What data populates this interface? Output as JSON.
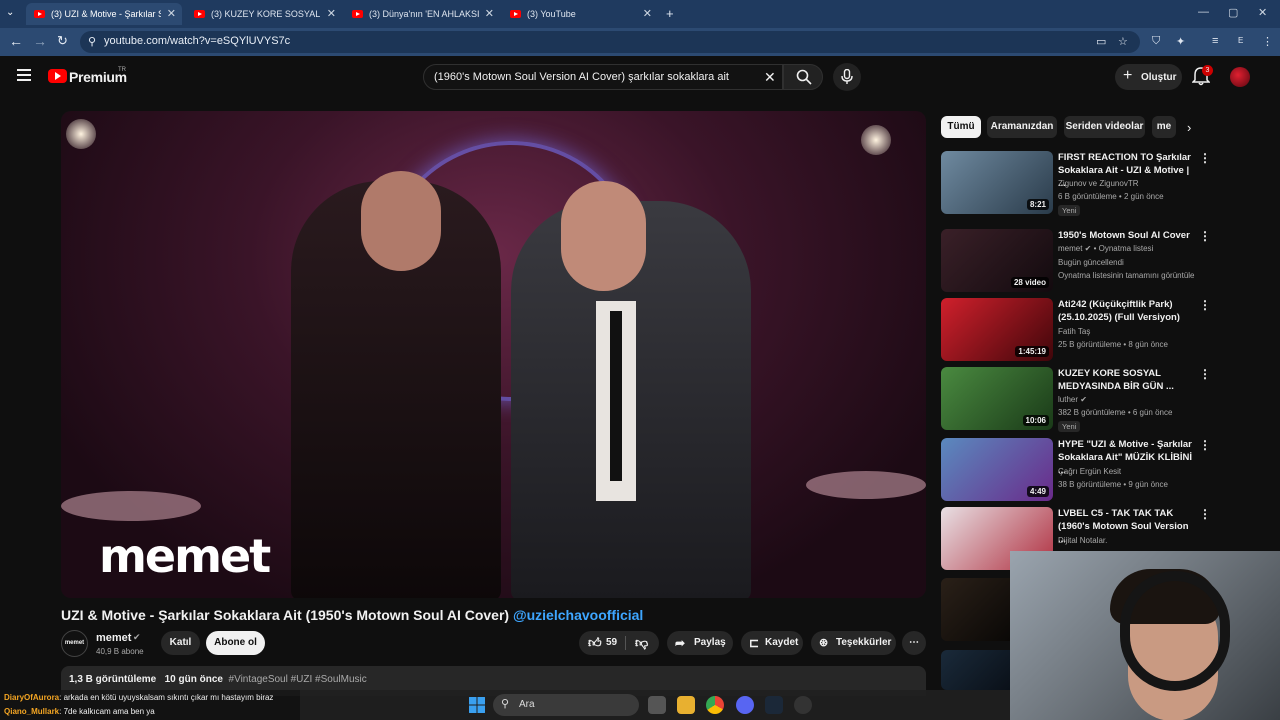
{
  "browser": {
    "tabs": [
      {
        "title": "(3) UZI & Motive - Şarkılar Soka",
        "active": true
      },
      {
        "title": "(3) KUZEY KORE SOSYAL MEDYA",
        "active": false
      },
      {
        "title": "(3) Dünya'nın 'EN AHLAKSIZ' B",
        "active": false
      },
      {
        "title": "(3) YouTube",
        "active": false
      }
    ],
    "new_tab": "+",
    "url": "youtube.com/watch?v=eSQYlUVYS7c",
    "profile_initial": "E"
  },
  "header": {
    "logo_text": "Premium",
    "logo_region": "TR",
    "search_value": "(1960's Motown Soul Version AI Cover) şarkılar sokaklara ait",
    "create_label": "Oluştur",
    "notification_count": "3"
  },
  "video": {
    "watermark": "memet",
    "title": "UZI & Motive - Şarkılar Sokaklara Ait (1950's Motown Soul AI Cover)",
    "title_tag": "@uzielchavoofficial",
    "channel": {
      "name": "memet",
      "subscribers": "40,9 B abone",
      "avatar_text": "memet"
    },
    "join_label": "Katıl",
    "subscribe_label": "Abone ol",
    "like_count": "59",
    "share_label": "Paylaş",
    "save_label": "Kaydet",
    "thanks_label": "Teşekkürler",
    "views": "1,3 B görüntüleme",
    "age": "10 gün önce",
    "hashtags": "#VintageSoul #UZI #SoulMusic"
  },
  "chips": [
    "Tümü",
    "Aramanızdan",
    "Seriden videolar",
    "me"
  ],
  "related": [
    {
      "title": "FIRST REACTION TO Şarkılar Sokaklara Ait - UZI & Motive | ...",
      "channel": "Zigunov ve ZigunovTR",
      "meta": "6 B görüntüleme • 2 gün önce",
      "duration": "8:21",
      "badge": "Yeni"
    },
    {
      "title": "1950's Motown Soul AI Cover",
      "channel": "memet ✔ • Oynatma listesi",
      "meta": "Bugün güncellendi",
      "meta2": "Oynatma listesinin tamamını görüntüle",
      "duration": "28 video"
    },
    {
      "title": "Ati242 (Küçükçiftlik Park) (25.10.2025) (Full Versiyon)",
      "channel": "Fatih Taş",
      "meta": "25 B görüntüleme • 8 gün önce",
      "duration": "1:45:19"
    },
    {
      "title": "KUZEY KORE SOSYAL MEDYASINDA BİR GÜN ...",
      "channel": "luther ✔",
      "meta": "382 B görüntüleme • 6 gün önce",
      "duration": "10:06",
      "badge": "Yeni"
    },
    {
      "title": "HYPE \"UZI & Motive - Şarkılar Sokaklara Ait\" MÜZİK KLİBİNİ ...",
      "channel": "Çağrı Ergün Kesit",
      "meta": "38 B görüntüleme • 9 gün önce",
      "duration": "4:49"
    },
    {
      "title": "LVBEL C5 - TAK TAK TAK (1960's Motown Soul Version ...",
      "channel": "Dijital Notalar.",
      "meta": "",
      "duration": ""
    }
  ],
  "chat": [
    {
      "user": "DiaryOfAurora",
      "text": ": arkada en kötü uyuyskalsam sıkıntı çıkar mı hastayım biraz"
    },
    {
      "user": "Qiano_Mullark",
      "text": ": 7de kalkıcam ama ben ya"
    }
  ],
  "taskbar": {
    "search_label": "Ara"
  },
  "colors": {
    "accent_red": "#ff0000",
    "link_blue": "#3ea6ff",
    "browser_frame": "#1f3a5f"
  }
}
